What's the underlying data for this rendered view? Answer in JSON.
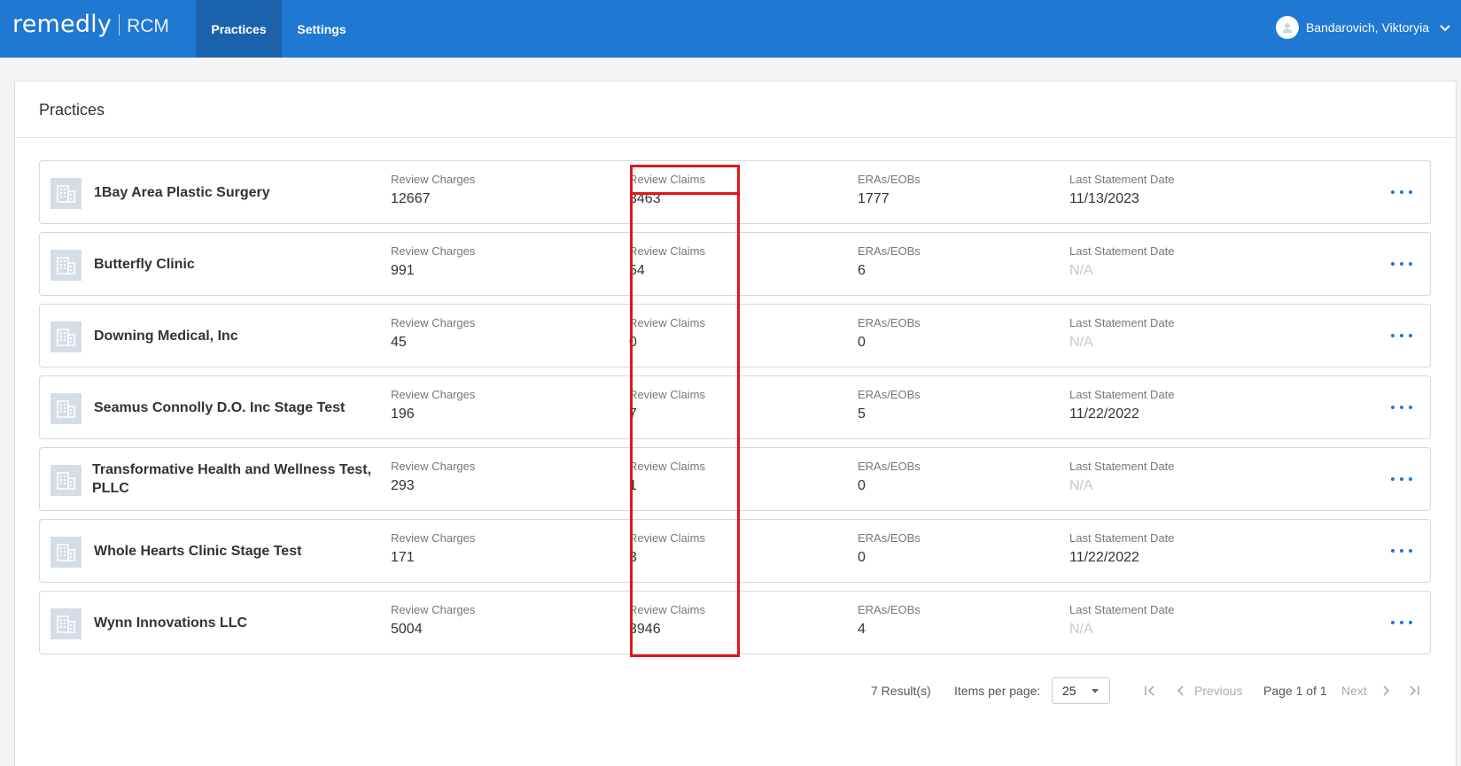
{
  "header": {
    "logo_main": "remedly",
    "logo_sub": "RCM",
    "tabs": [
      {
        "label": "Practices",
        "active": true
      },
      {
        "label": "Settings",
        "active": false
      }
    ],
    "user_name": "Bandarovich, Viktoryia"
  },
  "page": {
    "title": "Practices"
  },
  "columns": {
    "review_charges": "Review Charges",
    "review_claims": "Review Claims",
    "eras_eobs": "ERAs/EOBs",
    "last_statement_date": "Last Statement Date"
  },
  "practices": [
    {
      "name": "1Bay Area Plastic Surgery",
      "review_charges": "12667",
      "review_claims": "3463",
      "eras_eobs": "1777",
      "last_statement_date": "11/13/2023"
    },
    {
      "name": "Butterfly Clinic",
      "review_charges": "991",
      "review_claims": "54",
      "eras_eobs": "6",
      "last_statement_date": "N/A"
    },
    {
      "name": "Downing Medical, Inc",
      "review_charges": "45",
      "review_claims": "0",
      "eras_eobs": "0",
      "last_statement_date": "N/A"
    },
    {
      "name": "Seamus Connolly D.O. Inc Stage Test",
      "review_charges": "196",
      "review_claims": "7",
      "eras_eobs": "5",
      "last_statement_date": "11/22/2022"
    },
    {
      "name": "Transformative Health and Wellness Test, PLLC",
      "review_charges": "293",
      "review_claims": "1",
      "eras_eobs": "0",
      "last_statement_date": "N/A"
    },
    {
      "name": "Whole Hearts Clinic Stage Test",
      "review_charges": "171",
      "review_claims": "3",
      "eras_eobs": "0",
      "last_statement_date": "11/22/2022"
    },
    {
      "name": "Wynn Innovations LLC",
      "review_charges": "5004",
      "review_claims": "3946",
      "eras_eobs": "4",
      "last_statement_date": "N/A"
    }
  ],
  "pagination": {
    "results": "7 Result(s)",
    "items_per_page_label": "Items per page:",
    "items_per_page_value": "25",
    "previous_label": "Previous",
    "page_info": "Page 1 of 1",
    "next_label": "Next"
  },
  "colors": {
    "header_bg": "#1f78d1",
    "active_tab_bg": "#1b62ad",
    "highlight": "#e0141b",
    "na_text": "#c8c8c8"
  }
}
